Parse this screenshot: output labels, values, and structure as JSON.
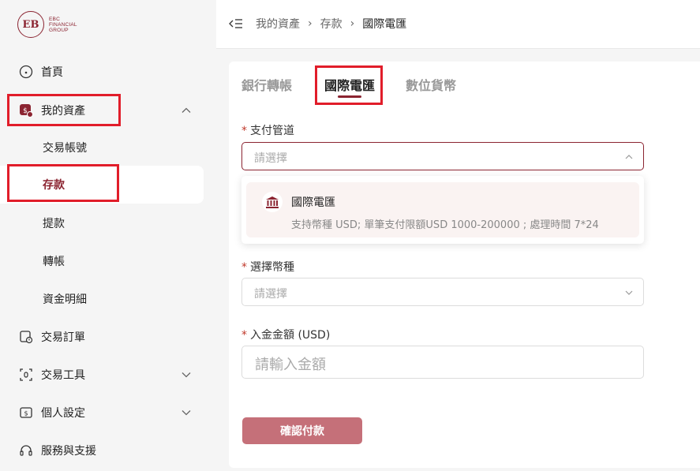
{
  "brand": {
    "logo_mark": "EB",
    "line1": "EBC",
    "line2": "FINANCIAL",
    "line3": "GROUP",
    "accent": "#8b2431"
  },
  "sidebar": {
    "items": [
      {
        "label": "首頁",
        "icon": "home-icon"
      },
      {
        "label": "我的資產",
        "icon": "assets-icon"
      },
      {
        "label": "交易訂單",
        "icon": "orders-icon"
      },
      {
        "label": "交易工具",
        "icon": "tools-icon"
      },
      {
        "label": "個人設定",
        "icon": "settings-icon"
      },
      {
        "label": "服務與支援",
        "icon": "headset-icon"
      }
    ],
    "sub_items": [
      {
        "label": "交易帳號"
      },
      {
        "label": "存款"
      },
      {
        "label": "提款"
      },
      {
        "label": "轉帳"
      },
      {
        "label": "資金明細"
      }
    ]
  },
  "breadcrumb": {
    "items": [
      "我的資產",
      "存款"
    ],
    "current": "國際電匯"
  },
  "tabs": [
    {
      "label": "銀行轉帳"
    },
    {
      "label": "國際電匯"
    },
    {
      "label": "數位貨幣"
    }
  ],
  "form": {
    "required_mark": "*",
    "payment_channel": {
      "label": "支付管道",
      "placeholder": "請選擇"
    },
    "channel_option": {
      "title": "國際電匯",
      "desc": "支持幣種 USD;    單筆支付限額USD 1000-200000 ;    處理時間 7*24"
    },
    "currency": {
      "label": "選擇幣種",
      "placeholder": "請選擇"
    },
    "amount": {
      "label": "入金金額 (USD)",
      "placeholder": "請輸入金額"
    },
    "confirm_label": "確認付款"
  }
}
